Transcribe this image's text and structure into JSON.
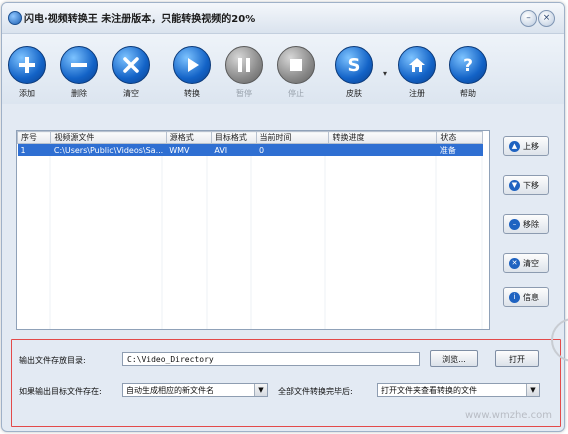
{
  "window": {
    "title": "闪电·视频转换王 未注册版本，只能转换视频的20%",
    "controls": {
      "minimize": "–",
      "close": "×"
    }
  },
  "toolbar": {
    "add": "添加",
    "delete": "删除",
    "clear": "清空",
    "convert": "转换",
    "pause": "暂停",
    "stop": "停止",
    "skin": "皮肤",
    "register": "注册",
    "help": "帮助"
  },
  "file_table": {
    "columns": [
      "序号",
      "视频源文件",
      "源格式",
      "目标格式",
      "当前时间",
      "转换进度",
      "状态"
    ],
    "rows": [
      {
        "index": "1",
        "source": "C:\\Users\\Public\\Videos\\Sa...",
        "src_format": "WMV",
        "dst_format": "AVI",
        "current_time": "0",
        "progress": "",
        "status": "准备"
      }
    ]
  },
  "side_buttons": {
    "up": "上移",
    "down": "下移",
    "remove": "移除",
    "clear": "清空",
    "info": "信息"
  },
  "output": {
    "dir_label": "输出文件存放目录:",
    "dir_value": "C:\\Video_Directory",
    "browse": "浏览...",
    "open": "打开",
    "exists_label": "如果输出目标文件存在:",
    "exists_option": "自动生成相应的新文件名",
    "after_label": "全部文件转换完毕后:",
    "after_option": "打开文件夹查看转换的文件"
  },
  "watermark": "www.wmzhe.com",
  "colors": {
    "accent_blue": "#1363c7",
    "selection": "#2f6fd2",
    "highlight_box": "#e34a4a"
  }
}
